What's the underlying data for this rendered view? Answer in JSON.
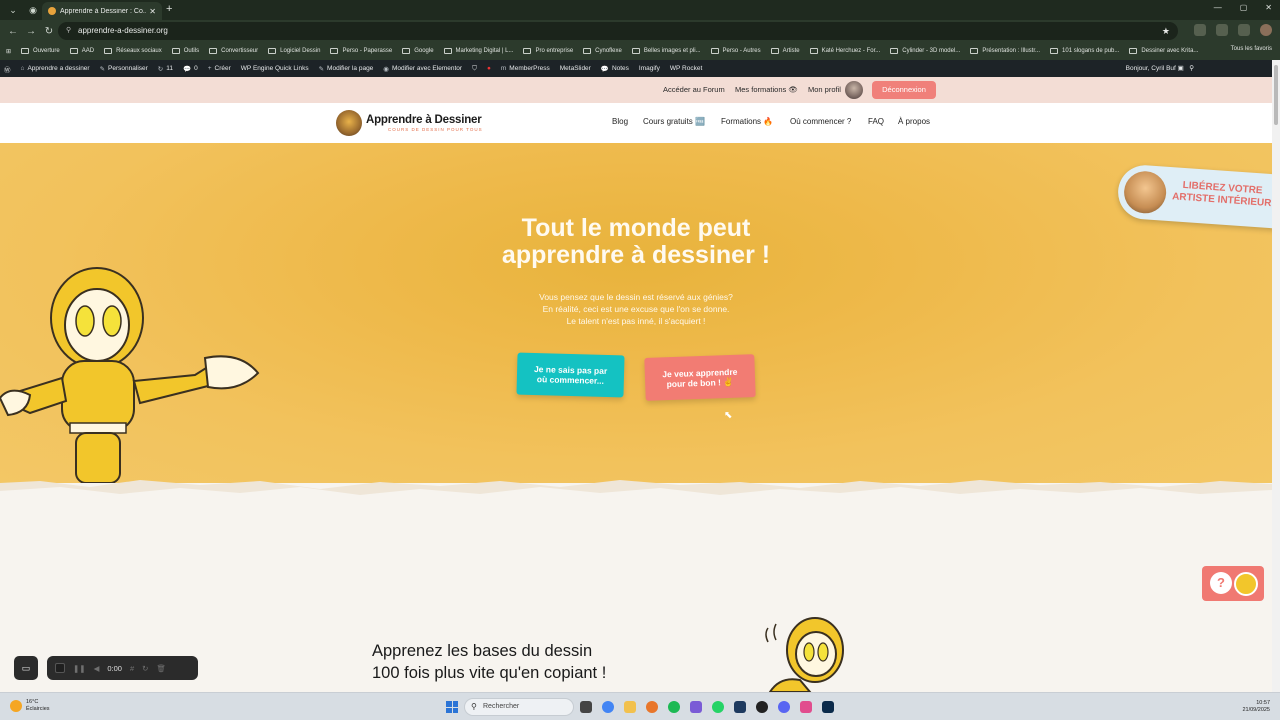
{
  "browser": {
    "tab_title": "Apprendre à Dessiner : Co...",
    "url": "apprendre-a-dessiner.org",
    "bookmarks": [
      "Ouverture",
      "AAD",
      "Réseaux sociaux",
      "Outils",
      "Convertisseur",
      "Logiciel Dessin",
      "Perso - Paperasse",
      "Google",
      "Marketing Digital | L...",
      "Pro entreprise",
      "Cynoflexe",
      "Belles images et pli...",
      "Perso - Autres",
      "Artiste",
      "Katé Herchuez - For...",
      "Cylinder - 3D model...",
      "Présentation : Illustr...",
      "101 slogans de pub...",
      "Dessiner avec Krita..."
    ],
    "all_favorites": "Tous les favoris"
  },
  "wp_admin": {
    "site": "Apprendre a dessiner",
    "customize": "Personnaliser",
    "updates": "11",
    "comments": "0",
    "new": "Créer",
    "quick_links": "WP Engine Quick Links",
    "edit_page": "Modifier la page",
    "elementor": "Modifier avec Elementor",
    "memberpress": "MemberPress",
    "metaslider": "MetaSlider",
    "notes": "Notes",
    "imagify": "Imagify",
    "rocket": "WP Rocket",
    "greeting": "Bonjour, Cyril Buf"
  },
  "topbar": {
    "forum": "Accéder au Forum",
    "courses": "Mes formations 👁",
    "profile": "Mon profil",
    "logout": "Déconnexion"
  },
  "nav": {
    "logo_title": "Apprendre à Dessiner",
    "logo_subtitle": "COURS DE DESSIN POUR TOUS",
    "items": [
      "Blog",
      "Cours gratuits 🆓",
      "Formations 🔥",
      "Où commencer ?",
      "FAQ",
      "À propos"
    ]
  },
  "hero": {
    "title_line1": "Tout le monde peut",
    "title_line2": "apprendre à dessiner !",
    "text_line1": "Vous pensez que le dessin est réservé aux génies?",
    "text_line2": "En réalité, ceci est une excuse que l'on se donne.",
    "text_line3": "Le talent n'est pas inné, il s'acquiert !",
    "button1_line1": "Je ne sais pas par",
    "button1_line2": "où commencer...",
    "button2_line1": "Je veux apprendre",
    "button2_line2": "pour de bon ! ✌",
    "badge_line1": "LIBÉREZ VOTRE",
    "badge_line2": "ARTISTE INTÉRIEUR"
  },
  "section2": {
    "title_line1": "Apprenez les bases du dessin",
    "title_line2": "100 fois plus vite qu'en copiant !"
  },
  "recorder": {
    "time": "0:00"
  },
  "taskbar": {
    "temp": "16°C",
    "weather": "Éclaircies",
    "search": "Rechercher",
    "time": "10:57",
    "date": "21/09/2025"
  },
  "colors": {
    "accent_teal": "#14c2c2",
    "accent_coral": "#f27c73",
    "hero_yellow": "#eeb94a"
  }
}
